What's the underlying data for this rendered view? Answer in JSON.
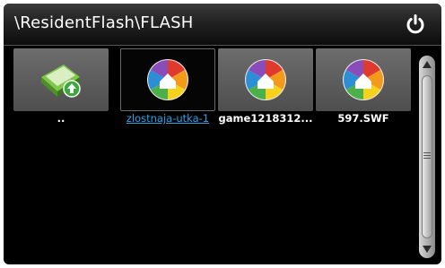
{
  "window": {
    "title": "\\ResidentFlash\\FLASH"
  },
  "files": [
    {
      "label": "..",
      "icon": "folder-up-icon",
      "selected": false
    },
    {
      "label": "zlostnaja-utka-1",
      "icon": "picasa-icon",
      "selected": true
    },
    {
      "label": "game1218312...",
      "icon": "picasa-icon",
      "selected": false
    },
    {
      "label": "597.SWF",
      "icon": "picasa-icon",
      "selected": false
    }
  ],
  "colors": {
    "background": "#000000",
    "selected_label": "#2aa3e6",
    "tile": "#5a5a5a"
  }
}
